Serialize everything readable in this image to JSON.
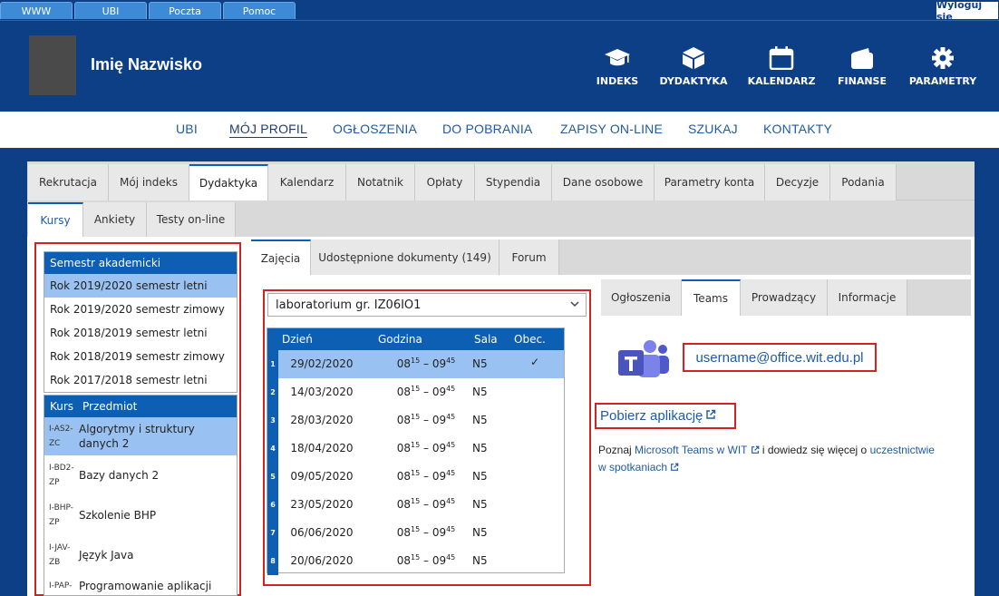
{
  "topbar": {
    "tabs": [
      "WWW",
      "UBI",
      "Poczta",
      "Pomoc"
    ],
    "logout": "Wyloguj się"
  },
  "header": {
    "user_name": "Imię Nazwisko",
    "icons": [
      {
        "label": "INDEKS",
        "icon": "graduation-cap-icon"
      },
      {
        "label": "DYDAKTYKA",
        "icon": "cube-icon"
      },
      {
        "label": "KALENDARZ",
        "icon": "calendar-icon"
      },
      {
        "label": "FINANSE",
        "icon": "wallet-icon"
      },
      {
        "label": "PARAMETRY",
        "icon": "gear-icon"
      }
    ]
  },
  "main_nav": {
    "items": [
      "UBI",
      "MÓJ PROFIL",
      "OGŁOSZENIA",
      "DO POBRANIA",
      "ZAPISY ON-LINE",
      "SZUKAJ",
      "KONTAKTY"
    ],
    "active": "MÓJ PROFIL"
  },
  "tabs_level1": {
    "items": [
      "Rekrutacja",
      "Mój indeks",
      "Dydaktyka",
      "Kalendarz",
      "Notatnik",
      "Opłaty",
      "Stypendia",
      "Dane osobowe",
      "Parametry konta",
      "Decyzje",
      "Podania"
    ],
    "active": "Dydaktyka"
  },
  "tabs_level2": {
    "items": [
      "Kursy",
      "Ankiety",
      "Testy on-line"
    ],
    "active": "Kursy"
  },
  "semesters": {
    "header": "Semestr akademicki",
    "items": [
      "Rok 2019/2020 semestr letni",
      "Rok 2019/2020 semestr zimowy",
      "Rok 2018/2019 semestr letni",
      "Rok 2018/2019 semestr zimowy",
      "Rok 2017/2018 semestr letni"
    ],
    "selected": "Rok 2019/2020 semestr letni"
  },
  "courses": {
    "header_code": "Kurs",
    "header_name": "Przedmiot",
    "items": [
      {
        "code": "I-AS2-ZC",
        "name": "Algorytmy i struktury danych 2"
      },
      {
        "code": "I-BD2-ZP",
        "name": "Bazy danych 2"
      },
      {
        "code": "I-BHP-ZP",
        "name": "Szkolenie BHP"
      },
      {
        "code": "I-JAV-ZB",
        "name": "Język Java"
      },
      {
        "code": "I-PAP-",
        "name": "Programowanie aplikacji"
      }
    ],
    "selected": "I-AS2-ZC"
  },
  "course_tabs": {
    "items": [
      "Zajęcia",
      "Udostępnione dokumenty (149)",
      "Forum"
    ],
    "active": "Zajęcia"
  },
  "group_select": {
    "value": "laboratorium gr. IZ06IO1"
  },
  "schedule": {
    "headers": {
      "day": "Dzień",
      "time": "Godzina",
      "room": "Sala",
      "attendance": "Obec."
    },
    "rows": [
      {
        "num": "1",
        "date": "29/02/2020",
        "start_h": "08",
        "start_m": "15",
        "end_h": "09",
        "end_m": "45",
        "room": "N5",
        "present": "✓"
      },
      {
        "num": "2",
        "date": "14/03/2020",
        "start_h": "08",
        "start_m": "15",
        "end_h": "09",
        "end_m": "45",
        "room": "N5",
        "present": ""
      },
      {
        "num": "3",
        "date": "28/03/2020",
        "start_h": "08",
        "start_m": "15",
        "end_h": "09",
        "end_m": "45",
        "room": "N5",
        "present": ""
      },
      {
        "num": "4",
        "date": "18/04/2020",
        "start_h": "08",
        "start_m": "15",
        "end_h": "09",
        "end_m": "45",
        "room": "N5",
        "present": ""
      },
      {
        "num": "5",
        "date": "09/05/2020",
        "start_h": "08",
        "start_m": "15",
        "end_h": "09",
        "end_m": "45",
        "room": "N5",
        "present": ""
      },
      {
        "num": "6",
        "date": "23/05/2020",
        "start_h": "08",
        "start_m": "15",
        "end_h": "09",
        "end_m": "45",
        "room": "N5",
        "present": ""
      },
      {
        "num": "7",
        "date": "06/06/2020",
        "start_h": "08",
        "start_m": "15",
        "end_h": "09",
        "end_m": "45",
        "room": "N5",
        "present": ""
      },
      {
        "num": "8",
        "date": "20/06/2020",
        "start_h": "08",
        "start_m": "15",
        "end_h": "09",
        "end_m": "45",
        "room": "N5",
        "present": ""
      }
    ],
    "selected_index": 0
  },
  "info_tabs": {
    "items": [
      "Ogłoszenia",
      "Teams",
      "Prowadzący",
      "Informacje"
    ],
    "active": "Teams"
  },
  "teams": {
    "email": "username@office.wit.edu.pl",
    "download_link": "Pobierz aplikację",
    "info_prefix": "Poznaj ",
    "info_link1": "Microsoft Teams w WIT",
    "info_middle": " i dowiedz się więcej o ",
    "info_link2a": "uczestnictwie",
    "info_link2b": "w spotkaniach"
  },
  "colors": {
    "brand": "#0c3f85",
    "accent": "#0c5fb3",
    "selection": "#99c2f2",
    "highlight_border": "#d32222",
    "link": "#1e5ba8"
  }
}
